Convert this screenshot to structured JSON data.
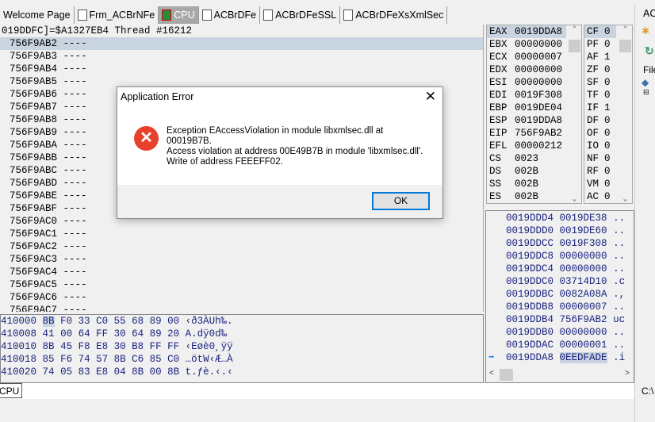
{
  "tabs": [
    {
      "label": "Welcome Page",
      "icon": "none"
    },
    {
      "label": "Frm_ACBrNFe",
      "icon": "form-icon"
    },
    {
      "label": "CPU",
      "icon": "cpu-bug-icon",
      "active": true
    },
    {
      "label": "ACBrDFe",
      "icon": "unit-file-icon"
    },
    {
      "label": "ACBrDFeSSL",
      "icon": "unit-file-icon"
    },
    {
      "label": "ACBrDFeXsXmlSec",
      "icon": "unit-file-icon"
    }
  ],
  "disasm": {
    "header": "019DDFC]=$A1327EB4 Thread #16212",
    "rows": [
      "756F9AB2 ----",
      "756F9AB3 ----",
      "756F9AB4 ----",
      "756F9AB5 ----",
      "756F9AB6 ----",
      "756F9AB7 ----",
      "756F9AB8 ----",
      "756F9AB9 ----",
      "756F9ABA ----",
      "756F9ABB ----",
      "756F9ABC ----",
      "756F9ABD ----",
      "756F9ABE ----",
      "756F9ABF ----",
      "756F9AC0 ----",
      "756F9AC1 ----",
      "756F9AC2 ----",
      "756F9AC3 ----",
      "756F9AC4 ----",
      "756F9AC5 ----",
      "756F9AC6 ----",
      "756F9AC7 ----"
    ]
  },
  "registers": [
    [
      "EAX",
      "0019DDA8"
    ],
    [
      "EBX",
      "00000000"
    ],
    [
      "ECX",
      "00000007"
    ],
    [
      "EDX",
      "00000000"
    ],
    [
      "ESI",
      "00000000"
    ],
    [
      "EDI",
      "0019F308"
    ],
    [
      "EBP",
      "0019DE04"
    ],
    [
      "ESP",
      "0019DDA8"
    ],
    [
      "EIP",
      "756F9AB2"
    ],
    [
      "EFL",
      "00000212"
    ],
    [
      "CS",
      "0023"
    ],
    [
      "DS",
      "002B"
    ],
    [
      "SS",
      "002B"
    ],
    [
      "ES",
      "002B"
    ]
  ],
  "flags": [
    [
      "CF",
      "0"
    ],
    [
      "PF",
      "0"
    ],
    [
      "AF",
      "1"
    ],
    [
      "ZF",
      "0"
    ],
    [
      "SF",
      "0"
    ],
    [
      "TF",
      "0"
    ],
    [
      "IF",
      "1"
    ],
    [
      "DF",
      "0"
    ],
    [
      "OF",
      "0"
    ],
    [
      "IO",
      "0"
    ],
    [
      "NF",
      "0"
    ],
    [
      "RF",
      "0"
    ],
    [
      "VM",
      "0"
    ],
    [
      "AC",
      "0"
    ]
  ],
  "stack": [
    [
      "0019DDD4",
      "0019DE38",
      ".."
    ],
    [
      "0019DDD0",
      "0019DE60",
      ".."
    ],
    [
      "0019DDCC",
      "0019F308",
      ".."
    ],
    [
      "0019DDC8",
      "00000000",
      ".."
    ],
    [
      "0019DDC4",
      "00000000",
      ".."
    ],
    [
      "0019DDC0",
      "03714D10",
      ".c"
    ],
    [
      "0019DDBC",
      "0082A08A",
      ".,"
    ],
    [
      "0019DDB8",
      "00000007",
      ".."
    ],
    [
      "0019DDB4",
      "756F9AB2",
      "uc"
    ],
    [
      "0019DDB0",
      "00000000",
      ".."
    ],
    [
      "0019DDAC",
      "00000001",
      ".."
    ],
    [
      "0019DDA8",
      "0EEDFADE",
      ".i"
    ]
  ],
  "dump": [
    [
      "410000",
      "8B",
      "F0 33 C0 55 68 89 00",
      "‹ð3ÀUh‰."
    ],
    [
      "410008",
      "41",
      "00 64 FF 30 64 89 20",
      "A.dÿ0d‰"
    ],
    [
      "410010",
      "8B",
      "45 F8 E8 30 B8 FF FF",
      "‹Eøè0¸ÿÿ"
    ],
    [
      "410018",
      "85",
      "F6 74 57 8B C6 85 C0",
      "…ötW‹Æ…À"
    ],
    [
      "410020",
      "74",
      "05 83 E8 04 8B 00 8B",
      "t.ƒè.‹.‹"
    ]
  ],
  "bottom_tab": "CPU",
  "side": {
    "tab": "AC",
    "file_label": "File",
    "path": "C:\\"
  },
  "dialog": {
    "title": "Application Error",
    "message_lines": [
      "Exception EAccessViolation in module libxmlsec.dll at",
      "00019B7B.",
      "Access violation at address 00E49B7B in module 'libxmlsec.dll'.",
      "Write of address FEEEFF02."
    ],
    "ok_label": "OK",
    "icon": "error-icon",
    "icon_color": "#e8412c"
  }
}
